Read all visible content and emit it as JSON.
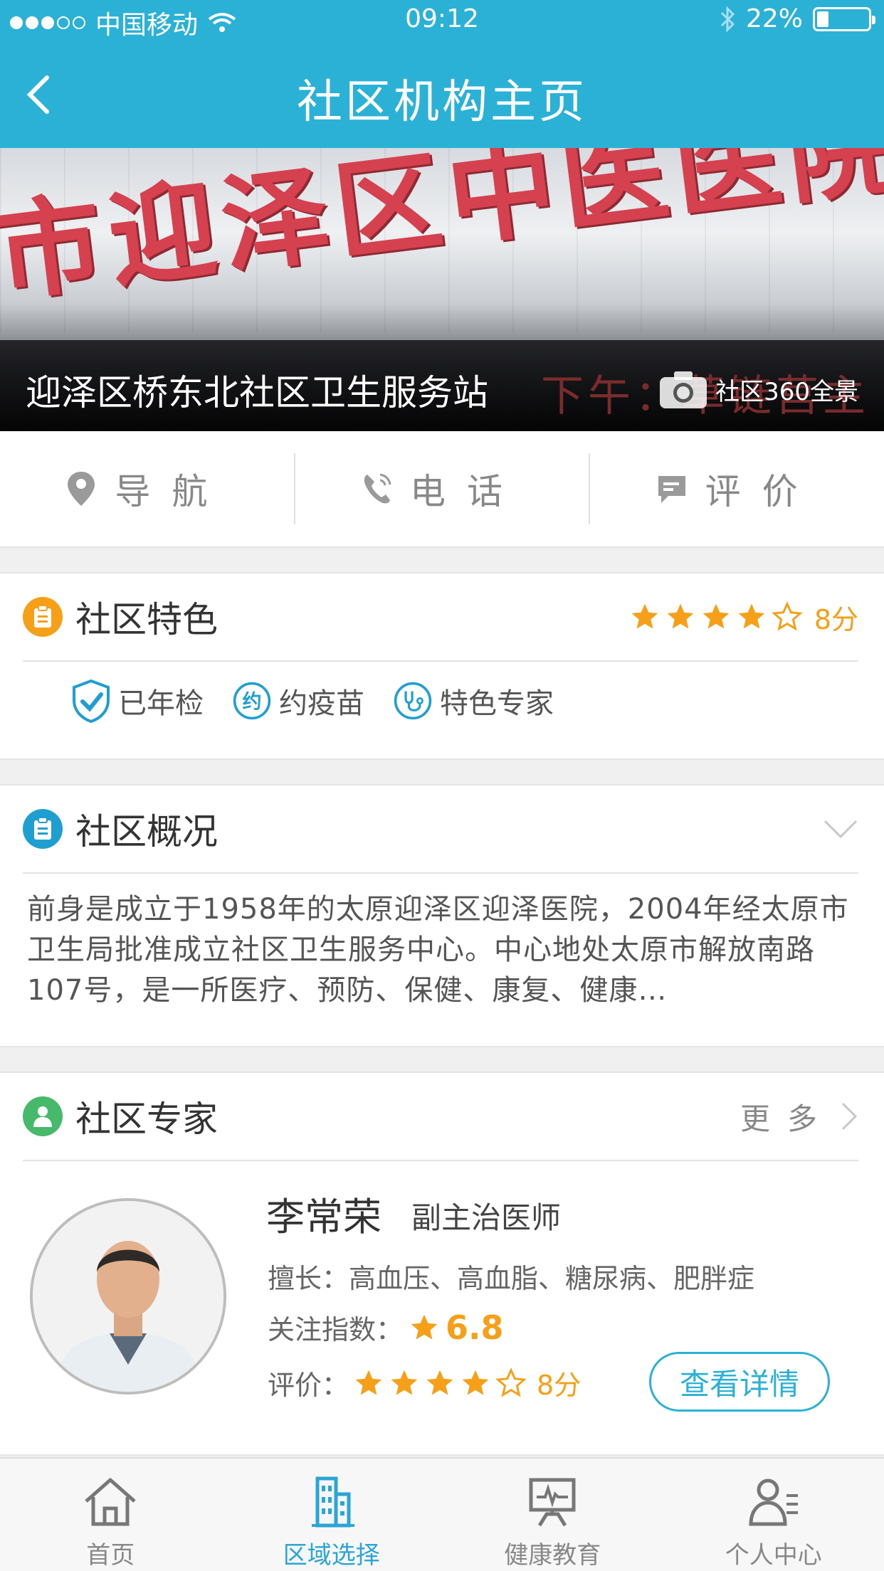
{
  "status_bar": {
    "carrier": "中国移动",
    "time": "09:12",
    "battery": "22%",
    "battery_level": 0.22
  },
  "nav": {
    "title": "社区机构主页"
  },
  "banner": {
    "sign": "市迎泽区中医医院",
    "led": "下午：草链莒主",
    "name": "迎泽区桥东北社区卫生服务站",
    "pano_label": "社区360全景"
  },
  "actions": [
    {
      "label": "导航",
      "icon": "location-pin-icon"
    },
    {
      "label": "电话",
      "icon": "phone-icon"
    },
    {
      "label": "评价",
      "icon": "comment-icon"
    }
  ],
  "features_section": {
    "title": "社区特色",
    "rating": 4,
    "rating_max": 5,
    "score": "8分",
    "tags": [
      {
        "label": "已年检",
        "icon": "shield-check-icon"
      },
      {
        "label": "约疫苗",
        "icon": "appointment-icon",
        "glyph": "约"
      },
      {
        "label": "特色专家",
        "icon": "stethoscope-icon"
      }
    ],
    "icon_color": "#f6a01a"
  },
  "overview_section": {
    "title": "社区概况",
    "text": "前身是成立于1958年的太原迎泽区迎泽医院，2004年经太原市卫生局批准成立社区卫生服务中心。中心地处太原市解放南路107号，是一所医疗、预防、保健、康复、健康…",
    "icon_color": "#1e9fd0"
  },
  "experts_section": {
    "title": "社区专家",
    "more": "更多",
    "icon_color": "#46b96a",
    "doctor": {
      "name": "李常荣",
      "title": "副主治医师",
      "specialty_label": "擅长：",
      "specialty": "高血压、高血脂、糖尿病、肥胖症",
      "follow_label": "关注指数：",
      "follow_value": "6.8",
      "rating_label": "评价：",
      "rating": 4,
      "rating_max": 5,
      "score": "8分",
      "detail_button": "查看详情"
    }
  },
  "tabbar": [
    {
      "label": "首页",
      "icon": "home-icon",
      "active": false
    },
    {
      "label": "区域选择",
      "icon": "building-icon",
      "active": true
    },
    {
      "label": "健康教育",
      "icon": "health-board-icon",
      "active": false
    },
    {
      "label": "个人中心",
      "icon": "profile-icon",
      "active": false
    }
  ],
  "colors": {
    "primary": "#2bb0d6",
    "star": "#f6a01a",
    "tab_active": "#2ba4d6"
  }
}
